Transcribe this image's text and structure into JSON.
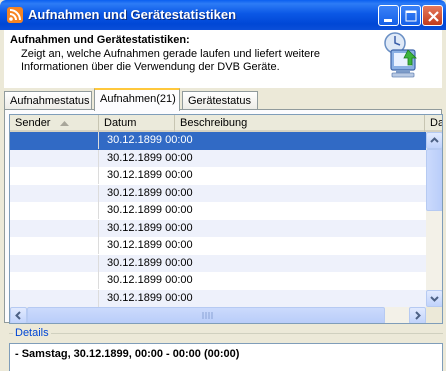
{
  "window": {
    "title": "Aufnahmen und Gerätestatistiken"
  },
  "header": {
    "title": "Aufnahmen und Gerätestatistiken:",
    "description": "Zeigt an, welche Aufnahmen gerade laufen und liefert weitere Informationen über die Verwendung der DVB Geräte."
  },
  "tabs": [
    {
      "label": "Aufnahmestatus",
      "active": false
    },
    {
      "label": "Aufnahmen(21)",
      "active": true
    },
    {
      "label": "Gerätestatus",
      "active": false
    }
  ],
  "table": {
    "columns": [
      "Sender",
      "Datum",
      "Beschreibung",
      "Da"
    ],
    "sort_column": "Sender",
    "sort_direction": "ascending",
    "rows": [
      {
        "sender": "",
        "datum": "30.12.1899 00:00",
        "beschreibung": ""
      },
      {
        "sender": "",
        "datum": "30.12.1899 00:00",
        "beschreibung": ""
      },
      {
        "sender": "",
        "datum": "30.12.1899 00:00",
        "beschreibung": ""
      },
      {
        "sender": "",
        "datum": "30.12.1899 00:00",
        "beschreibung": ""
      },
      {
        "sender": "",
        "datum": "30.12.1899 00:00",
        "beschreibung": ""
      },
      {
        "sender": "",
        "datum": "30.12.1899 00:00",
        "beschreibung": ""
      },
      {
        "sender": "",
        "datum": "30.12.1899 00:00",
        "beschreibung": ""
      },
      {
        "sender": "",
        "datum": "30.12.1899 00:00",
        "beschreibung": ""
      },
      {
        "sender": "",
        "datum": "30.12.1899 00:00",
        "beschreibung": ""
      },
      {
        "sender": "",
        "datum": "30.12.1899 00:00",
        "beschreibung": ""
      }
    ],
    "selected_row": 0
  },
  "details": {
    "legend": "Details",
    "text": "- Samstag, 30.12.1899, 00:00 - 00:00  (00:00)"
  },
  "colors": {
    "selection": "#316ac5",
    "titlebar": "#0b58e6",
    "legend": "#0046d5"
  }
}
